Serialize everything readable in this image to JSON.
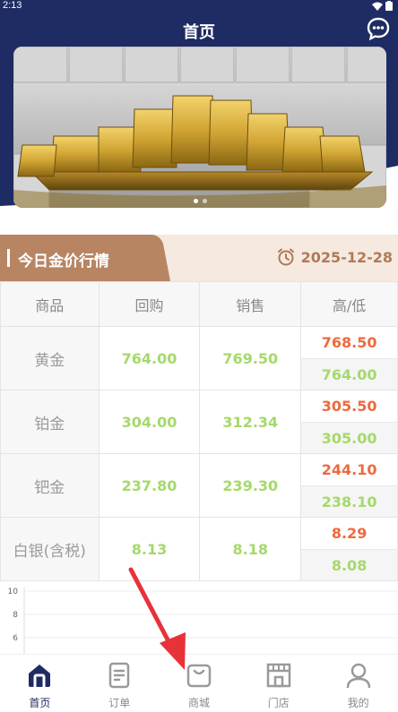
{
  "status_bar": {
    "time": "2:13"
  },
  "header": {
    "title": "首页",
    "chat_icon": "chat-bubble-icon"
  },
  "banner": {
    "dots": 2,
    "active_dot": 0
  },
  "market": {
    "title": "今日金价行情",
    "date": "2025-12-28",
    "columns": [
      "商品",
      "回购",
      "销售",
      "高/低"
    ],
    "rows": [
      {
        "name": "黄金",
        "buy": "764.00",
        "sell": "769.50",
        "high": "768.50",
        "low": "764.00"
      },
      {
        "name": "铂金",
        "buy": "304.00",
        "sell": "312.34",
        "high": "305.50",
        "low": "305.00"
      },
      {
        "name": "钯金",
        "buy": "237.80",
        "sell": "239.30",
        "high": "244.10",
        "low": "238.10"
      },
      {
        "name": "白银(含税)",
        "buy": "8.13",
        "sell": "8.18",
        "high": "8.29",
        "low": "8.08"
      }
    ]
  },
  "chart_data": {
    "type": "line",
    "y_ticks": [
      "10",
      "8",
      "6"
    ],
    "series": []
  },
  "tabbar": {
    "items": [
      {
        "label": "首页",
        "icon": "home-icon",
        "active": true
      },
      {
        "label": "订单",
        "icon": "order-icon",
        "active": false
      },
      {
        "label": "商城",
        "icon": "shopping-bag-icon",
        "active": false
      },
      {
        "label": "门店",
        "icon": "store-icon",
        "active": false
      },
      {
        "label": "我的",
        "icon": "profile-icon",
        "active": false
      }
    ]
  },
  "colors": {
    "header_navy": "#1f2b63",
    "section_brown": "#b88563",
    "rise_red": "#ee6a3e",
    "fall_green": "#a5d96a"
  }
}
